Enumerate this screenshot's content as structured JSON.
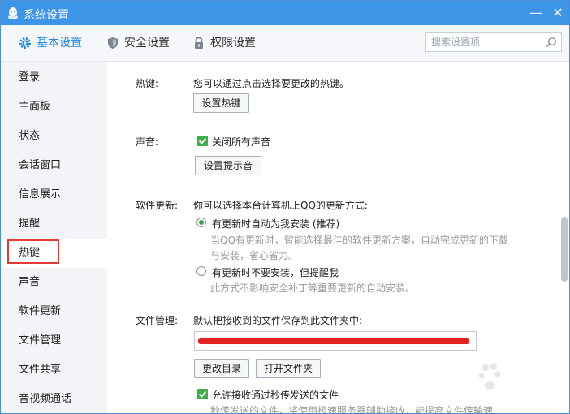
{
  "window": {
    "title": "系统设置",
    "minimize_glyph": "—",
    "close_glyph": "✕"
  },
  "tabs": [
    {
      "label": "基本设置",
      "icon": "gear-icon",
      "active": true
    },
    {
      "label": "安全设置",
      "icon": "shield-icon",
      "active": false
    },
    {
      "label": "权限设置",
      "icon": "lock-icon",
      "active": false
    }
  ],
  "search": {
    "placeholder": "搜索设置项",
    "value": ""
  },
  "sidebar": {
    "items": [
      {
        "label": "登录"
      },
      {
        "label": "主面板"
      },
      {
        "label": "状态"
      },
      {
        "label": "会话窗口"
      },
      {
        "label": "信息展示"
      },
      {
        "label": "提醒"
      },
      {
        "label": "热键",
        "active": true
      },
      {
        "label": "声音"
      },
      {
        "label": "软件更新"
      },
      {
        "label": "文件管理"
      },
      {
        "label": "文件共享"
      },
      {
        "label": "音视频通话"
      }
    ]
  },
  "hotkey": {
    "section_label": "热键:",
    "description": "您可以通过点击选择要更改的热键。",
    "button_label": "设置热键"
  },
  "sound": {
    "section_label": "声音:",
    "checkbox_label": "关闭所有声音",
    "checked": true,
    "button_label": "设置提示音"
  },
  "update": {
    "section_label": "软件更新:",
    "description": "你可以选择本台计算机上QQ的更新方式:",
    "options": [
      {
        "label": "有更新时自动为我安装 (推荐)",
        "selected": true,
        "desc_line1": "当QQ有更新时，智能选择最佳的软件更新方案，自动完成更新的下载",
        "desc_line2": "与安装，省心省力。"
      },
      {
        "label": "有更新时不要安装，但提醒我",
        "selected": false,
        "desc_line1": "此方式不影响安全补丁等重要更新的自动安装。"
      }
    ]
  },
  "files": {
    "section_label": "文件管理:",
    "description": "默认把接收到的文件保存到此文件夹中:",
    "change_dir_label": "更改目录",
    "open_folder_label": "打开文件夹",
    "checkbox_label": "允许接收通过秒传发送的文件",
    "checked": true,
    "checkbox_desc": "秒传发送的文件，将使用极速服务器辅助接收，能提高文件传输速"
  },
  "colors": {
    "titlebar": "#3d95e8",
    "accent": "#1e88e5",
    "highlight_box": "#e53935",
    "check_green": "#3fae4a"
  }
}
